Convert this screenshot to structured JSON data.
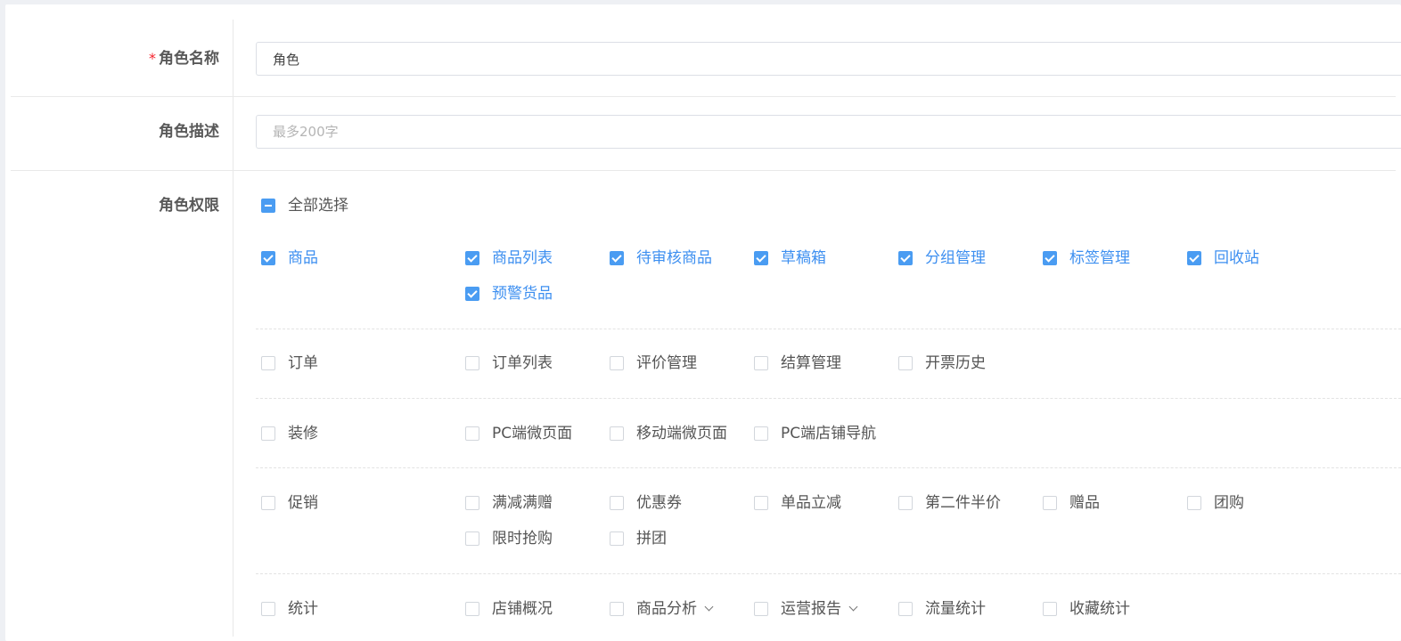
{
  "form": {
    "name": {
      "required_mark": "*",
      "label": "角色名称",
      "value": "角色"
    },
    "description": {
      "label": "角色描述",
      "placeholder": "最多200字"
    },
    "permissions": {
      "label": "角色权限",
      "select_all": "全部选择",
      "select_all_state": "indeterminate"
    }
  },
  "groups": [
    {
      "label": "商品",
      "checked": true,
      "items": [
        {
          "label": "商品列表",
          "checked": true
        },
        {
          "label": "待审核商品",
          "checked": true
        },
        {
          "label": "草稿箱",
          "checked": true
        },
        {
          "label": "分组管理",
          "checked": true
        },
        {
          "label": "标签管理",
          "checked": true
        },
        {
          "label": "回收站",
          "checked": true
        },
        {
          "label": "预警货品",
          "checked": true
        }
      ]
    },
    {
      "label": "订单",
      "checked": false,
      "items": [
        {
          "label": "订单列表",
          "checked": false
        },
        {
          "label": "评价管理",
          "checked": false
        },
        {
          "label": "结算管理",
          "checked": false
        },
        {
          "label": "开票历史",
          "checked": false
        }
      ]
    },
    {
      "label": "装修",
      "checked": false,
      "items": [
        {
          "label": "PC端微页面",
          "checked": false
        },
        {
          "label": "移动端微页面",
          "checked": false
        },
        {
          "label": "PC端店铺导航",
          "checked": false
        }
      ]
    },
    {
      "label": "促销",
      "checked": false,
      "items": [
        {
          "label": "满减满赠",
          "checked": false
        },
        {
          "label": "优惠券",
          "checked": false
        },
        {
          "label": "单品立减",
          "checked": false
        },
        {
          "label": "第二件半价",
          "checked": false
        },
        {
          "label": "赠品",
          "checked": false
        },
        {
          "label": "团购",
          "checked": false
        },
        {
          "label": "限时抢购",
          "checked": false
        },
        {
          "label": "拼团",
          "checked": false
        }
      ]
    },
    {
      "label": "统计",
      "checked": false,
      "items": [
        {
          "label": "店铺概况",
          "checked": false
        },
        {
          "label": "商品分析",
          "checked": false,
          "dropdown": true
        },
        {
          "label": "运营报告",
          "checked": false,
          "dropdown": true
        },
        {
          "label": "流量统计",
          "checked": false
        },
        {
          "label": "收藏统计",
          "checked": false
        }
      ]
    }
  ],
  "colors": {
    "accent": "#4a9cf2",
    "checked_text": "#3d8ff0",
    "required": "#f5222d"
  }
}
